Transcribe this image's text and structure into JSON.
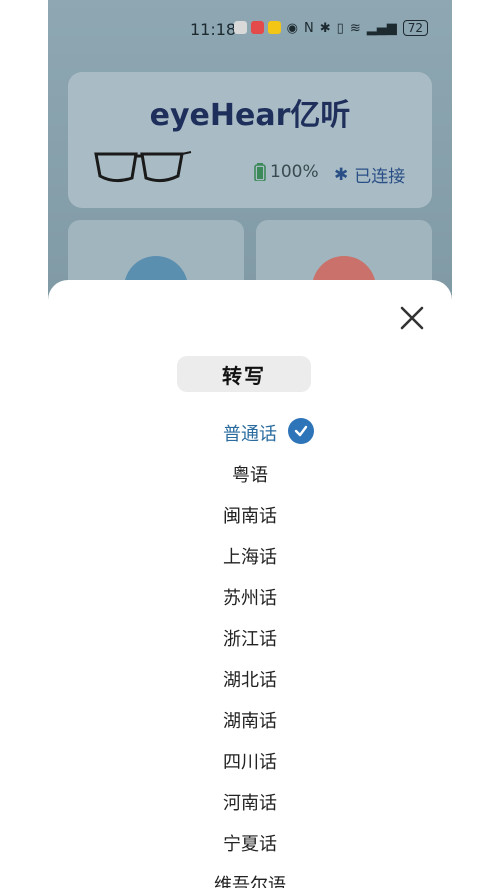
{
  "status_bar": {
    "time": "11:18",
    "battery": "72"
  },
  "device": {
    "brand": "eyeHear亿听",
    "battery_pct": "100%",
    "connection": "已连接"
  },
  "sheet": {
    "title": "转写",
    "languages": [
      {
        "label": "普通话",
        "selected": true
      },
      {
        "label": "粤语",
        "selected": false
      },
      {
        "label": "闽南话",
        "selected": false
      },
      {
        "label": "上海话",
        "selected": false
      },
      {
        "label": "苏州话",
        "selected": false
      },
      {
        "label": "浙江话",
        "selected": false
      },
      {
        "label": "湖北话",
        "selected": false
      },
      {
        "label": "湖南话",
        "selected": false
      },
      {
        "label": "四川话",
        "selected": false
      },
      {
        "label": "河南话",
        "selected": false
      },
      {
        "label": "宁夏话",
        "selected": false
      },
      {
        "label": "维吾尔语",
        "selected": false
      }
    ]
  },
  "colors": {
    "accent": "#2d74b8",
    "selected_text": "#2a6ca0",
    "brand": "#1f2f5c"
  }
}
